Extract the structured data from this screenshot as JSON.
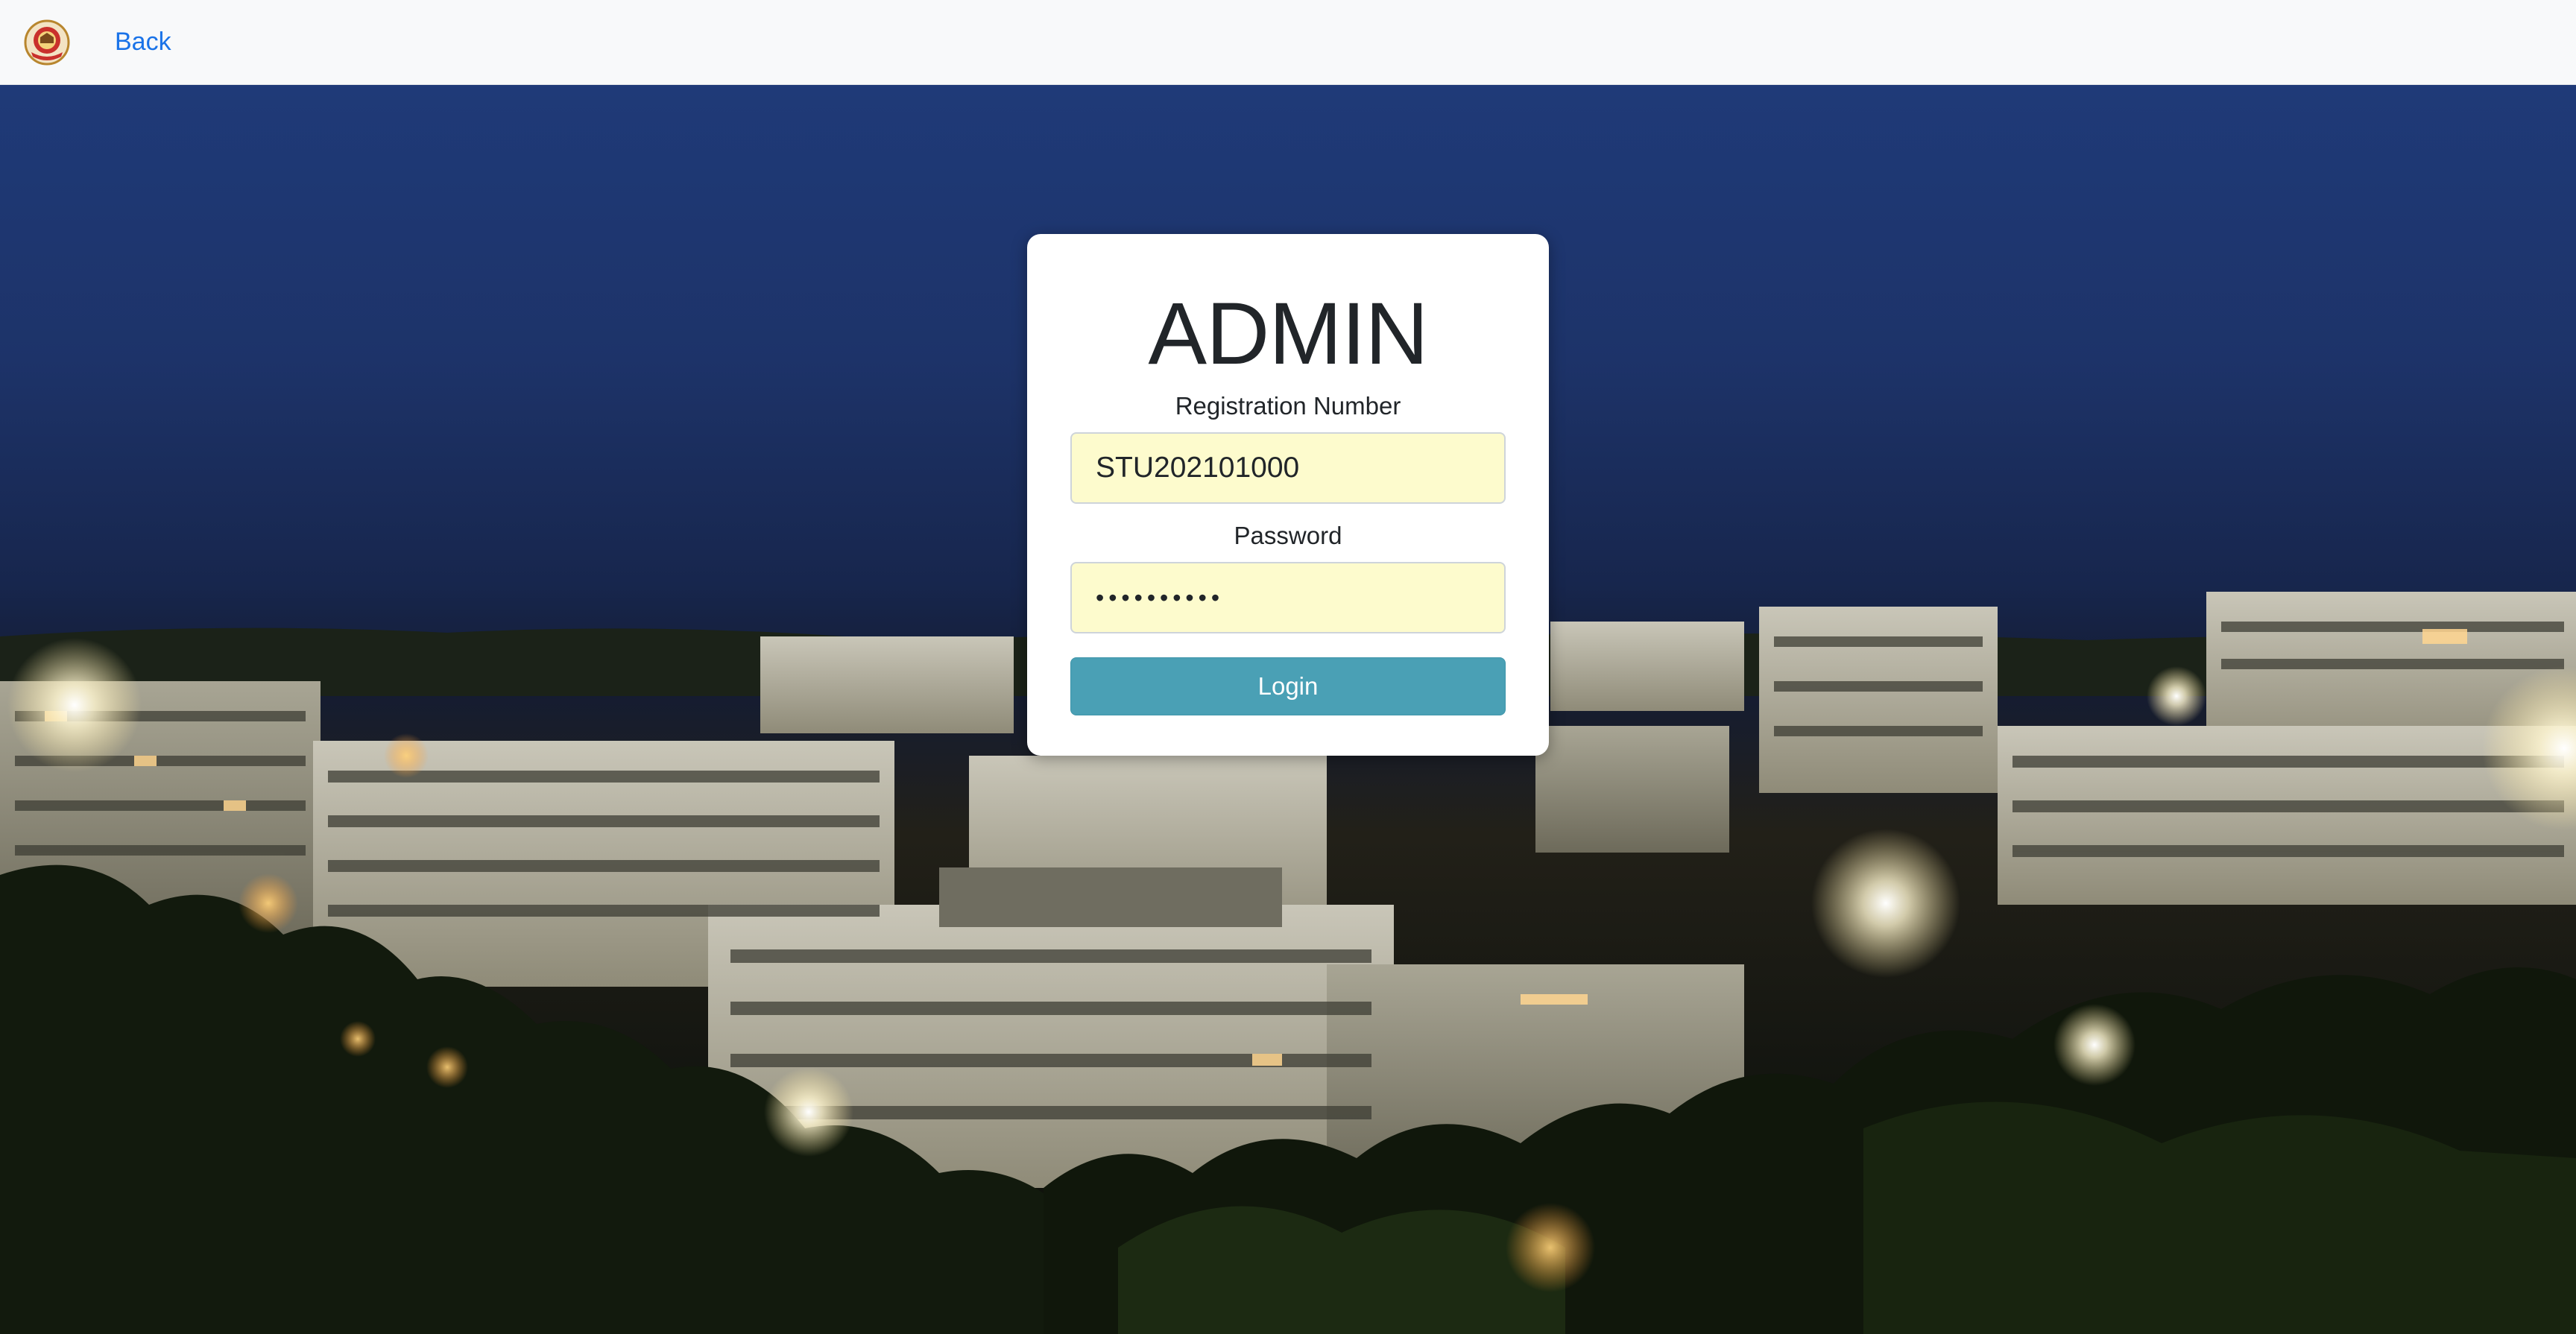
{
  "navbar": {
    "back_label": "Back"
  },
  "login_card": {
    "title": "ADMIN",
    "registration_label": "Registration Number",
    "registration_value": "STU202101000",
    "password_label": "Password",
    "password_value": "••••••••••",
    "login_label": "Login"
  },
  "colors": {
    "navbar_bg": "#f8f9fa",
    "link": "#1a73e8",
    "input_bg": "#fdfbcd",
    "button": "#4aa0b5",
    "sky": "#1f3a78"
  },
  "icons": {
    "logo": "college-emblem-icon"
  }
}
